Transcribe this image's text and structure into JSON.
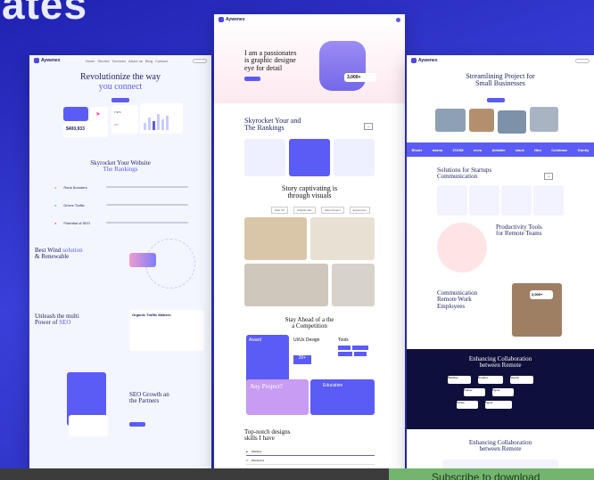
{
  "hero_text": "ates",
  "left_page": {
    "brand": "Aywenex",
    "nav_links": [
      "Home",
      "Service",
      "Services",
      "About us",
      "Blog",
      "Contact"
    ],
    "hero_title_line1": "Revolutionize the way",
    "hero_title_accent": "you connect",
    "stat_value": "$400,933",
    "stat_small": "7,974",
    "stat_small2": "287",
    "rank_title_line1": "Skyrocket Your Website",
    "rank_title_accent": "The Rankings",
    "features": [
      {
        "title": "Rank Boosters"
      },
      {
        "title": "Drives Traffic"
      },
      {
        "title": "Potential of SEO"
      }
    ],
    "wind_title": "Best Wind",
    "wind_accent": "solution",
    "wind_line2": "& Renewable",
    "multi_title_line1": "Unleash the multi",
    "multi_title_line2": "Power of",
    "multi_accent": "SEO",
    "organic_title": "Organic Traffic Matters",
    "growth_title_line1": "SEO Growth an",
    "growth_title_line2": "the Partners"
  },
  "center_page": {
    "brand": "Aywenex",
    "hero_line1": "I am a passionates",
    "hero_line2": "is graphic designe",
    "hero_line3": "eye for detail",
    "badge_value": "3,000+",
    "rank_line1": "Skyrocket Your and",
    "rank_line2": "The Rankings",
    "story_line1": "Story captivating is",
    "story_line2": "through visuals",
    "tabs": [
      "Web UX",
      "Graphic Dev",
      "Video Project",
      "Experience"
    ],
    "ahead_line1": "Stay Ahead of  a the",
    "ahead_line2": "a Competition",
    "card_award": "Award",
    "card_uiux": "UI/Ux Design",
    "card_tools": "Tools",
    "count_value": "20+",
    "any_project": "Any Project?",
    "education": "Education",
    "skills_line1": "Top-notch designs",
    "skills_line2": "skills I have",
    "skill_items": [
      "Webflow",
      "Wordpress"
    ]
  },
  "right_page": {
    "brand": "Aywenex",
    "hero_line1": "Streamlining Project for",
    "hero_line2": "Small Businesses",
    "logos": [
      "Bissix",
      "asana",
      "ZOOM",
      "envu",
      "Airtable",
      "slack",
      "Nbu",
      "Coinbase",
      "Guntly"
    ],
    "solutions_line1": "Solutions for Startups",
    "solutions_line2": "Communication",
    "productivity_line1": "Productivity Tools",
    "productivity_line2": "for Remote Teams",
    "comm_line1": "Communication",
    "comm_line2": "Remote Work",
    "comm_line3": "Employees",
    "comm_badge": "2,000+",
    "enh_line1": "Enhancing Collaboration",
    "enh_line2": "between Remote",
    "apps": [
      "Webflow",
      "Dropbox",
      "Shopify",
      "Framer",
      "Figma",
      "Github",
      "Figma"
    ],
    "enh2_line1": "Enhancing Collaboration",
    "enh2_line2": "between Remote"
  },
  "footer": {
    "subscribe": "Subscribe to download"
  }
}
